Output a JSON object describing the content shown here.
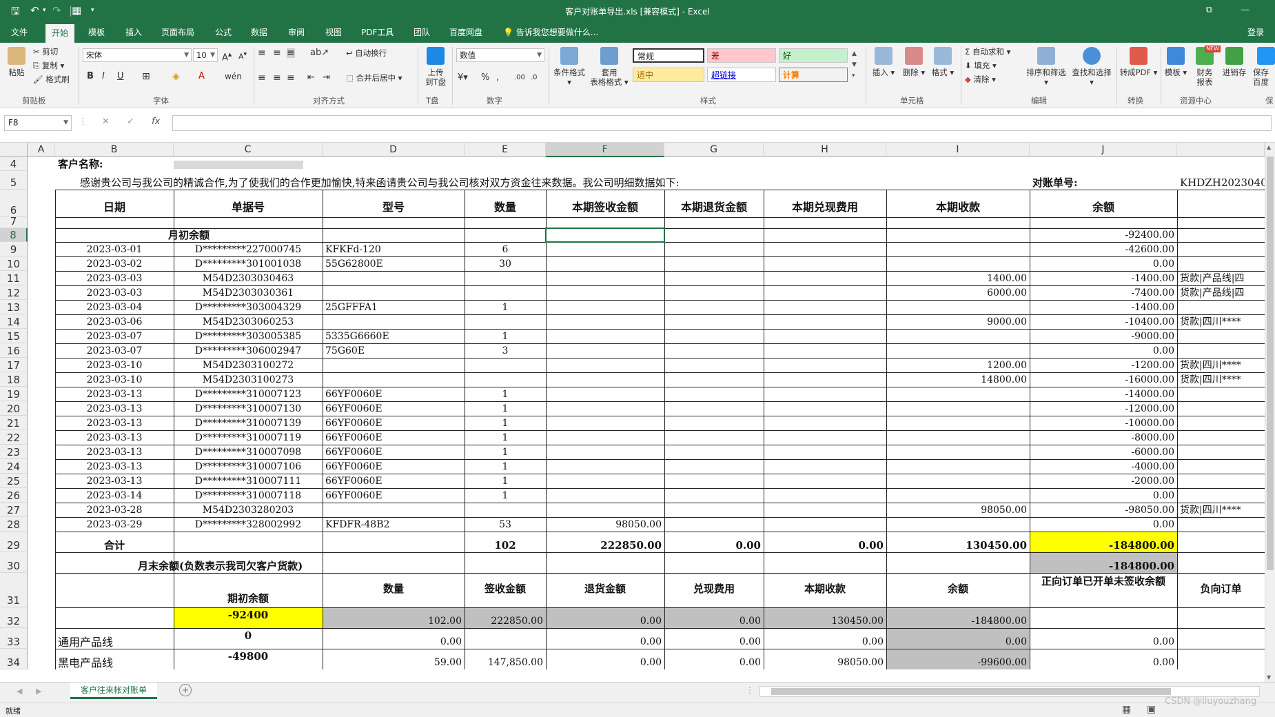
{
  "window": {
    "title": "客户对账单导出.xls  [兼容模式] - Excel",
    "login": "登录",
    "tell_me": "告诉我您想要做什么..."
  },
  "tabs": [
    "文件",
    "开始",
    "模板",
    "插入",
    "页面布局",
    "公式",
    "数据",
    "审阅",
    "视图",
    "PDF工具",
    "团队",
    "百度网盘"
  ],
  "active_tab": "开始",
  "ribbon": {
    "clipboard": {
      "group": "剪贴板",
      "paste": "粘贴",
      "cut": "剪切",
      "copy": "复制",
      "format_painter": "格式刷"
    },
    "font": {
      "group": "字体",
      "name": "宋体",
      "size": "10"
    },
    "alignment": {
      "group": "对齐方式",
      "wrap": "自动换行",
      "merge": "合并后居中"
    },
    "tpan": {
      "group": "T盘",
      "upload_1": "上传",
      "upload_2": "到T盘"
    },
    "number": {
      "group": "数字",
      "format": "数值"
    },
    "styles": {
      "group": "样式",
      "cond_fmt": "条件格式",
      "table_fmt_1": "套用",
      "table_fmt_2": "表格格式",
      "normal": "常规",
      "bad": "差",
      "good": "好",
      "neutral": "适中",
      "hyperlink": "超链接",
      "calc": "计算"
    },
    "cells": {
      "group": "单元格",
      "insert": "插入",
      "delete": "删除",
      "format": "格式"
    },
    "editing": {
      "group": "编辑",
      "autosum": "自动求和",
      "fill": "填充",
      "clear": "清除",
      "sort": "排序和筛选",
      "find": "查找和选择"
    },
    "convert": {
      "group": "转换",
      "to_pdf": "转成PDF"
    },
    "resource": {
      "group": "资源中心",
      "template": "模板",
      "finance_1": "财务",
      "finance_2": "报表",
      "jxc": "进销存",
      "new_badge": "NEW",
      "save_1": "保存",
      "save_2": "百度",
      "save_group": "保"
    }
  },
  "formula_bar": {
    "name_box": "F8",
    "fx": "fx",
    "content": ""
  },
  "columns": [
    "A",
    "B",
    "C",
    "D",
    "E",
    "F",
    "G",
    "H",
    "I",
    "J"
  ],
  "selected_col": "F",
  "selected_row": "8",
  "rows": [
    "4",
    "5",
    "6",
    "7",
    "8",
    "9",
    "10",
    "11",
    "12",
    "13",
    "14",
    "15",
    "16",
    "17",
    "18",
    "19",
    "20",
    "21",
    "22",
    "23",
    "24",
    "25",
    "26",
    "27",
    "28",
    "29",
    "30",
    "31",
    "32",
    "33",
    "34"
  ],
  "sheet": {
    "customer_label": "客户名称:",
    "intro": "感谢贵公司与我公司的精诚合作,为了使我们的合作更加愉快,特来函请贵公司与我公司核对双方资金往来数据。我公司明细数据如下:",
    "statement_no_label": "对账单号:",
    "statement_no": "KHDZH2023040",
    "headers": [
      "日期",
      "单据号",
      "型号",
      "数量",
      "本期签收金额",
      "本期退货金额",
      "本期兑现费用",
      "本期收款",
      "余额"
    ],
    "opening_label": "月初余额",
    "opening_balance": "-92400.00",
    "detail": [
      {
        "date": "2023-03-01",
        "doc": "D*********227000745",
        "model": "KFKFd-120",
        "qty": "6",
        "signed": "",
        "received": "",
        "balance": "-42600.00",
        "note": ""
      },
      {
        "date": "2023-03-02",
        "doc": "D*********301001038",
        "model": "55G62800E",
        "qty": "30",
        "signed": "",
        "received": "",
        "balance": "0.00",
        "note": ""
      },
      {
        "date": "2023-03-03",
        "doc": "M54D2303030463",
        "model": "",
        "qty": "",
        "signed": "",
        "received": "1400.00",
        "balance": "-1400.00",
        "note": "货款|产品线|四"
      },
      {
        "date": "2023-03-03",
        "doc": "M54D2303030361",
        "model": "",
        "qty": "",
        "signed": "",
        "received": "6000.00",
        "balance": "-7400.00",
        "note": "货款|产品线|四"
      },
      {
        "date": "2023-03-04",
        "doc": "D*********303004329",
        "model": "25GFFFA1",
        "qty": "1",
        "signed": "",
        "received": "",
        "balance": "-1400.00",
        "note": ""
      },
      {
        "date": "2023-03-06",
        "doc": "M54D2303060253",
        "model": "",
        "qty": "",
        "signed": "",
        "received": "9000.00",
        "balance": "-10400.00",
        "note": "货款|四川****"
      },
      {
        "date": "2023-03-07",
        "doc": "D*********303005385",
        "model": "5335G6660E",
        "qty": "1",
        "signed": "",
        "received": "",
        "balance": "-9000.00",
        "note": ""
      },
      {
        "date": "2023-03-07",
        "doc": "D*********306002947",
        "model": "75G60E",
        "qty": "3",
        "signed": "",
        "received": "",
        "balance": "0.00",
        "note": ""
      },
      {
        "date": "2023-03-10",
        "doc": "M54D2303100272",
        "model": "",
        "qty": "",
        "signed": "",
        "received": "1200.00",
        "balance": "-1200.00",
        "note": "货款|四川****"
      },
      {
        "date": "2023-03-10",
        "doc": "M54D2303100273",
        "model": "",
        "qty": "",
        "signed": "",
        "received": "14800.00",
        "balance": "-16000.00",
        "note": "货款|四川****"
      },
      {
        "date": "2023-03-13",
        "doc": "D*********310007123",
        "model": "66YF0060E",
        "qty": "1",
        "signed": "",
        "received": "",
        "balance": "-14000.00",
        "note": ""
      },
      {
        "date": "2023-03-13",
        "doc": "D*********310007130",
        "model": "66YF0060E",
        "qty": "1",
        "signed": "",
        "received": "",
        "balance": "-12000.00",
        "note": ""
      },
      {
        "date": "2023-03-13",
        "doc": "D*********310007139",
        "model": "66YF0060E",
        "qty": "1",
        "signed": "",
        "received": "",
        "balance": "-10000.00",
        "note": ""
      },
      {
        "date": "2023-03-13",
        "doc": "D*********310007119",
        "model": "66YF0060E",
        "qty": "1",
        "signed": "",
        "received": "",
        "balance": "-8000.00",
        "note": ""
      },
      {
        "date": "2023-03-13",
        "doc": "D*********310007098",
        "model": "66YF0060E",
        "qty": "1",
        "signed": "",
        "received": "",
        "balance": "-6000.00",
        "note": ""
      },
      {
        "date": "2023-03-13",
        "doc": "D*********310007106",
        "model": "66YF0060E",
        "qty": "1",
        "signed": "",
        "received": "",
        "balance": "-4000.00",
        "note": ""
      },
      {
        "date": "2023-03-13",
        "doc": "D*********310007111",
        "model": "66YF0060E",
        "qty": "1",
        "signed": "",
        "received": "",
        "balance": "-2000.00",
        "note": ""
      },
      {
        "date": "2023-03-14",
        "doc": "D*********310007118",
        "model": "66YF0060E",
        "qty": "1",
        "signed": "",
        "received": "",
        "balance": "0.00",
        "note": ""
      },
      {
        "date": "2023-03-28",
        "doc": "M54D2303280203",
        "model": "",
        "qty": "",
        "signed": "",
        "received": "98050.00",
        "balance": "-98050.00",
        "note": "货款|四川****"
      },
      {
        "date": "2023-03-29",
        "doc": "D*********328002992",
        "model": "KFDFR-48B2",
        "qty": "53",
        "signed": "98050.00",
        "received": "",
        "balance": "0.00",
        "note": ""
      }
    ],
    "total": {
      "label": "合计",
      "qty": "102",
      "signed": "222850.00",
      "returned": "0.00",
      "cashed": "0.00",
      "received": "130450.00",
      "balance": "-184800.00"
    },
    "closing": {
      "label": "月末余额(负数表示我司欠客户货款)",
      "balance": "-184800.00"
    },
    "summary_headers": [
      "期初余额",
      "数量",
      "签收金额",
      "退货金额",
      "兑现费用",
      "本期收款",
      "余额",
      "正向订单已开单未签收余额",
      "负向订单"
    ],
    "summary_rows": [
      {
        "label": "",
        "opening": "-92400",
        "qty": "102.00",
        "signed": "222850.00",
        "returned": "0.00",
        "cashed": "0.00",
        "received": "130450.00",
        "balance": "-184800.00",
        "pending": ""
      },
      {
        "label": "通用产品线",
        "opening": "0",
        "qty": "0.00",
        "signed": "",
        "returned": "0.00",
        "cashed": "0.00",
        "received": "0.00",
        "balance": "0.00",
        "pending": "0.00"
      },
      {
        "label": "黑电产品线",
        "opening": "-49800",
        "qty": "59.00",
        "signed": "147,850.00",
        "returned": "0.00",
        "cashed": "0.00",
        "received": "98050.00",
        "balance": "-99600.00",
        "pending": "0.00"
      }
    ]
  },
  "sheet_tab": "客户往来帐对账单",
  "status": {
    "ready": "就绪",
    "watermark": "CSDN @liuyouzhang"
  },
  "colors": {
    "excel_green": "#217346",
    "highlight_yellow": "#ffff00",
    "gray_fill": "#c0c0c0"
  }
}
